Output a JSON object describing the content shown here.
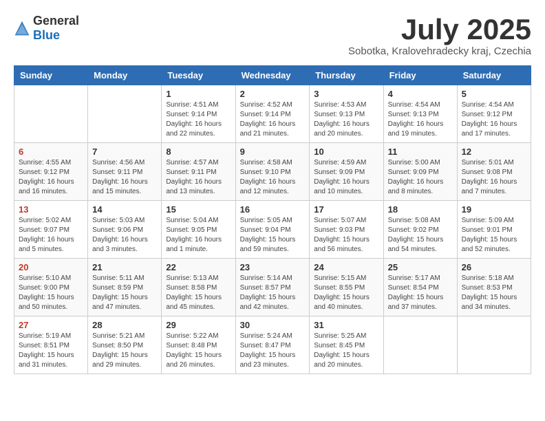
{
  "header": {
    "logo_general": "General",
    "logo_blue": "Blue",
    "month_title": "July 2025",
    "subtitle": "Sobotka, Kralovehradecky kraj, Czechia"
  },
  "columns": [
    "Sunday",
    "Monday",
    "Tuesday",
    "Wednesday",
    "Thursday",
    "Friday",
    "Saturday"
  ],
  "weeks": [
    [
      {
        "day": "",
        "info": ""
      },
      {
        "day": "",
        "info": ""
      },
      {
        "day": "1",
        "info": "Sunrise: 4:51 AM\nSunset: 9:14 PM\nDaylight: 16 hours\nand 22 minutes."
      },
      {
        "day": "2",
        "info": "Sunrise: 4:52 AM\nSunset: 9:14 PM\nDaylight: 16 hours\nand 21 minutes."
      },
      {
        "day": "3",
        "info": "Sunrise: 4:53 AM\nSunset: 9:13 PM\nDaylight: 16 hours\nand 20 minutes."
      },
      {
        "day": "4",
        "info": "Sunrise: 4:54 AM\nSunset: 9:13 PM\nDaylight: 16 hours\nand 19 minutes."
      },
      {
        "day": "5",
        "info": "Sunrise: 4:54 AM\nSunset: 9:12 PM\nDaylight: 16 hours\nand 17 minutes."
      }
    ],
    [
      {
        "day": "6",
        "info": "Sunrise: 4:55 AM\nSunset: 9:12 PM\nDaylight: 16 hours\nand 16 minutes."
      },
      {
        "day": "7",
        "info": "Sunrise: 4:56 AM\nSunset: 9:11 PM\nDaylight: 16 hours\nand 15 minutes."
      },
      {
        "day": "8",
        "info": "Sunrise: 4:57 AM\nSunset: 9:11 PM\nDaylight: 16 hours\nand 13 minutes."
      },
      {
        "day": "9",
        "info": "Sunrise: 4:58 AM\nSunset: 9:10 PM\nDaylight: 16 hours\nand 12 minutes."
      },
      {
        "day": "10",
        "info": "Sunrise: 4:59 AM\nSunset: 9:09 PM\nDaylight: 16 hours\nand 10 minutes."
      },
      {
        "day": "11",
        "info": "Sunrise: 5:00 AM\nSunset: 9:09 PM\nDaylight: 16 hours\nand 8 minutes."
      },
      {
        "day": "12",
        "info": "Sunrise: 5:01 AM\nSunset: 9:08 PM\nDaylight: 16 hours\nand 7 minutes."
      }
    ],
    [
      {
        "day": "13",
        "info": "Sunrise: 5:02 AM\nSunset: 9:07 PM\nDaylight: 16 hours\nand 5 minutes."
      },
      {
        "day": "14",
        "info": "Sunrise: 5:03 AM\nSunset: 9:06 PM\nDaylight: 16 hours\nand 3 minutes."
      },
      {
        "day": "15",
        "info": "Sunrise: 5:04 AM\nSunset: 9:05 PM\nDaylight: 16 hours\nand 1 minute."
      },
      {
        "day": "16",
        "info": "Sunrise: 5:05 AM\nSunset: 9:04 PM\nDaylight: 15 hours\nand 59 minutes."
      },
      {
        "day": "17",
        "info": "Sunrise: 5:07 AM\nSunset: 9:03 PM\nDaylight: 15 hours\nand 56 minutes."
      },
      {
        "day": "18",
        "info": "Sunrise: 5:08 AM\nSunset: 9:02 PM\nDaylight: 15 hours\nand 54 minutes."
      },
      {
        "day": "19",
        "info": "Sunrise: 5:09 AM\nSunset: 9:01 PM\nDaylight: 15 hours\nand 52 minutes."
      }
    ],
    [
      {
        "day": "20",
        "info": "Sunrise: 5:10 AM\nSunset: 9:00 PM\nDaylight: 15 hours\nand 50 minutes."
      },
      {
        "day": "21",
        "info": "Sunrise: 5:11 AM\nSunset: 8:59 PM\nDaylight: 15 hours\nand 47 minutes."
      },
      {
        "day": "22",
        "info": "Sunrise: 5:13 AM\nSunset: 8:58 PM\nDaylight: 15 hours\nand 45 minutes."
      },
      {
        "day": "23",
        "info": "Sunrise: 5:14 AM\nSunset: 8:57 PM\nDaylight: 15 hours\nand 42 minutes."
      },
      {
        "day": "24",
        "info": "Sunrise: 5:15 AM\nSunset: 8:55 PM\nDaylight: 15 hours\nand 40 minutes."
      },
      {
        "day": "25",
        "info": "Sunrise: 5:17 AM\nSunset: 8:54 PM\nDaylight: 15 hours\nand 37 minutes."
      },
      {
        "day": "26",
        "info": "Sunrise: 5:18 AM\nSunset: 8:53 PM\nDaylight: 15 hours\nand 34 minutes."
      }
    ],
    [
      {
        "day": "27",
        "info": "Sunrise: 5:19 AM\nSunset: 8:51 PM\nDaylight: 15 hours\nand 31 minutes."
      },
      {
        "day": "28",
        "info": "Sunrise: 5:21 AM\nSunset: 8:50 PM\nDaylight: 15 hours\nand 29 minutes."
      },
      {
        "day": "29",
        "info": "Sunrise: 5:22 AM\nSunset: 8:48 PM\nDaylight: 15 hours\nand 26 minutes."
      },
      {
        "day": "30",
        "info": "Sunrise: 5:24 AM\nSunset: 8:47 PM\nDaylight: 15 hours\nand 23 minutes."
      },
      {
        "day": "31",
        "info": "Sunrise: 5:25 AM\nSunset: 8:45 PM\nDaylight: 15 hours\nand 20 minutes."
      },
      {
        "day": "",
        "info": ""
      },
      {
        "day": "",
        "info": ""
      }
    ]
  ]
}
